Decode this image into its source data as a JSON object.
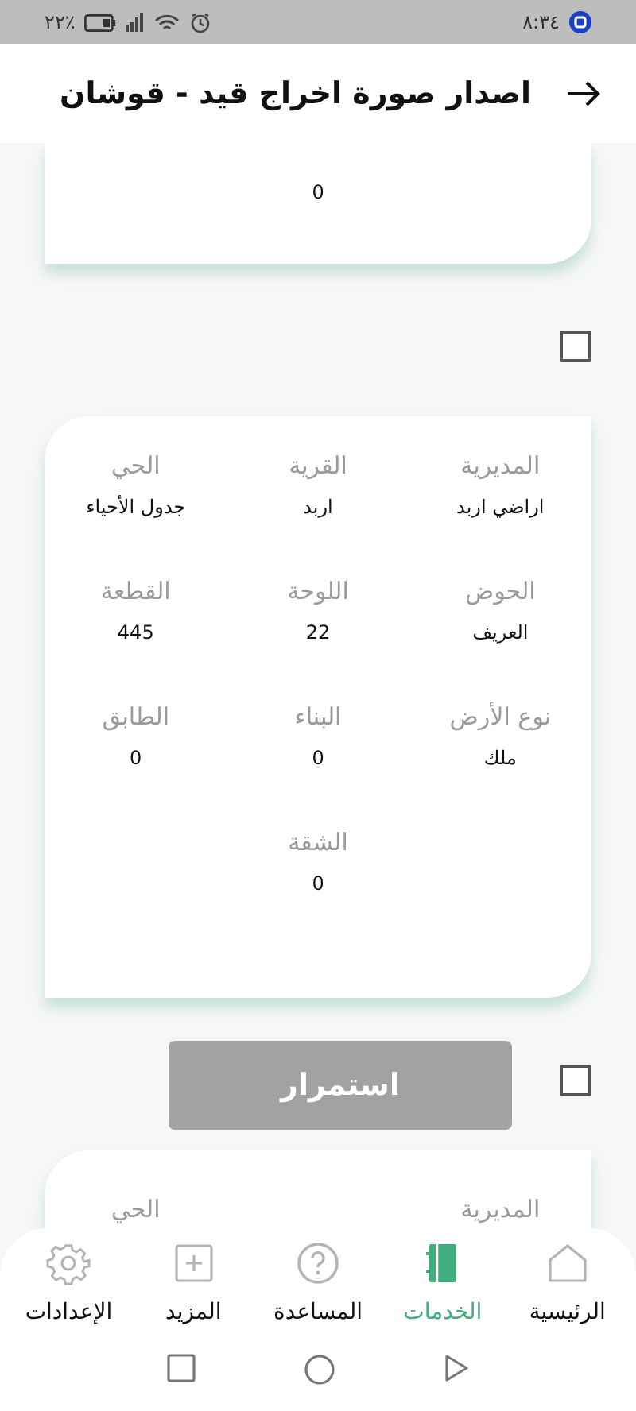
{
  "status_bar": {
    "time": "٨:٣٤",
    "battery": "٪٢٢"
  },
  "header": {
    "title": "اصدار صورة اخراج قيد - قوشان"
  },
  "records": [
    {
      "fields": [
        {
          "value": "0"
        }
      ]
    },
    {
      "checked": false,
      "fields": [
        {
          "label": "المديرية",
          "value": "اراضي اربد"
        },
        {
          "label": "القرية",
          "value": "اربد"
        },
        {
          "label": "الحي",
          "value": "جدول الأحياء"
        },
        {
          "label": "الحوض",
          "value": "العريف"
        },
        {
          "label": "اللوحة",
          "value": "22"
        },
        {
          "label": "القطعة",
          "value": "445"
        },
        {
          "label": "نوع الأرض",
          "value": "ملك"
        },
        {
          "label": "البناء",
          "value": "0"
        },
        {
          "label": "الطابق",
          "value": "0"
        },
        {
          "label": "الشقة",
          "value": "0"
        }
      ]
    },
    {
      "checked": false,
      "fields": [
        {
          "label": "المديرية"
        },
        {
          "label": "الحي"
        }
      ]
    }
  ],
  "continue_button": {
    "label": "استمرار",
    "disabled": true
  },
  "bottom_nav": [
    {
      "label": "الرئيسية",
      "selected": false
    },
    {
      "label": "الخدمات",
      "selected": true
    },
    {
      "label": "المساعدة",
      "selected": false
    },
    {
      "label": "المزيد",
      "selected": false
    },
    {
      "label": "الإعدادات",
      "selected": false
    }
  ]
}
